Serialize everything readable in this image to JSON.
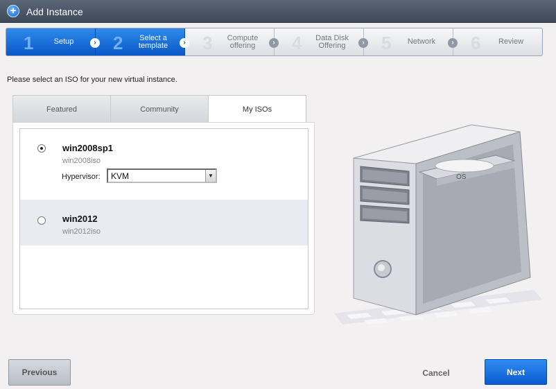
{
  "window": {
    "title": "Add Instance",
    "icon": "plus-icon"
  },
  "steps": [
    {
      "num": "1",
      "label": "Setup",
      "state": "completed"
    },
    {
      "num": "2",
      "label": "Select a template",
      "state": "active"
    },
    {
      "num": "3",
      "label": "Compute offering",
      "state": "pending"
    },
    {
      "num": "4",
      "label": "Data Disk Offering",
      "state": "pending"
    },
    {
      "num": "5",
      "label": "Network",
      "state": "pending"
    },
    {
      "num": "6",
      "label": "Review",
      "state": "pending"
    }
  ],
  "instruction": "Please select an ISO for your new virtual instance.",
  "tabs": [
    {
      "label": "Featured",
      "selected": false
    },
    {
      "label": "Community",
      "selected": false
    },
    {
      "label": "My ISOs",
      "selected": true
    }
  ],
  "isos": [
    {
      "name": "win2008sp1",
      "sub": "win2008iso",
      "selected": true
    },
    {
      "name": "win2012",
      "sub": "win2012iso",
      "selected": false
    }
  ],
  "hypervisor": {
    "label": "Hypervisor:",
    "value": "KVM"
  },
  "illustration": {
    "disc_label": "OS"
  },
  "buttons": {
    "previous": "Previous",
    "cancel": "Cancel",
    "next": "Next"
  },
  "colors": {
    "accent": "#0a57c9",
    "titlebar": "#4a5666"
  }
}
